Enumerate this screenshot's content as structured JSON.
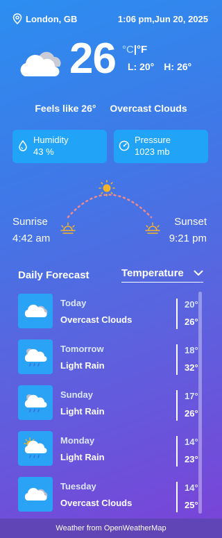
{
  "header": {
    "location": "London, GB",
    "datetime": "1:06 pm,Jun 20, 2025"
  },
  "current": {
    "temp": "26",
    "unit_c": "°C",
    "unit_sep": "|",
    "unit_f": "°F",
    "low": "L: 20°",
    "high": "H: 26°",
    "feels_like": "Feels like 26°",
    "condition": "Overcast Clouds"
  },
  "stats": {
    "humidity_label": "Humidity",
    "humidity_value": "43 %",
    "pressure_label": "Pressure",
    "pressure_value": "1023 mb"
  },
  "sun": {
    "sunrise_label": "Sunrise",
    "sunrise_time": "4:42 am",
    "sunset_label": "Sunset",
    "sunset_time": "9:21 pm"
  },
  "forecast": {
    "title": "Daily Forecast",
    "selected": "Temperature",
    "days": [
      {
        "day": "Today",
        "condition": "Overcast Clouds",
        "low": "20°",
        "high": "26°",
        "icon": "overcast-clouds-icon"
      },
      {
        "day": "Tomorrow",
        "condition": "Light Rain",
        "low": "18°",
        "high": "32°",
        "icon": "light-rain-icon"
      },
      {
        "day": "Sunday",
        "condition": "Light Rain",
        "low": "17°",
        "high": "26°",
        "icon": "light-rain-icon"
      },
      {
        "day": "Monday",
        "condition": "Light Rain",
        "low": "14°",
        "high": "23°",
        "icon": "sun-rain-icon"
      },
      {
        "day": "Tuesday",
        "condition": "Overcast Clouds",
        "low": "14°",
        "high": "25°",
        "icon": "overcast-clouds-icon"
      }
    ]
  },
  "footer": {
    "text": "Weather from OpenWeatherMap"
  },
  "colors": {
    "card_bg": "#21a4f7",
    "sun": "#f5b227",
    "arc": "#f08a8a"
  }
}
